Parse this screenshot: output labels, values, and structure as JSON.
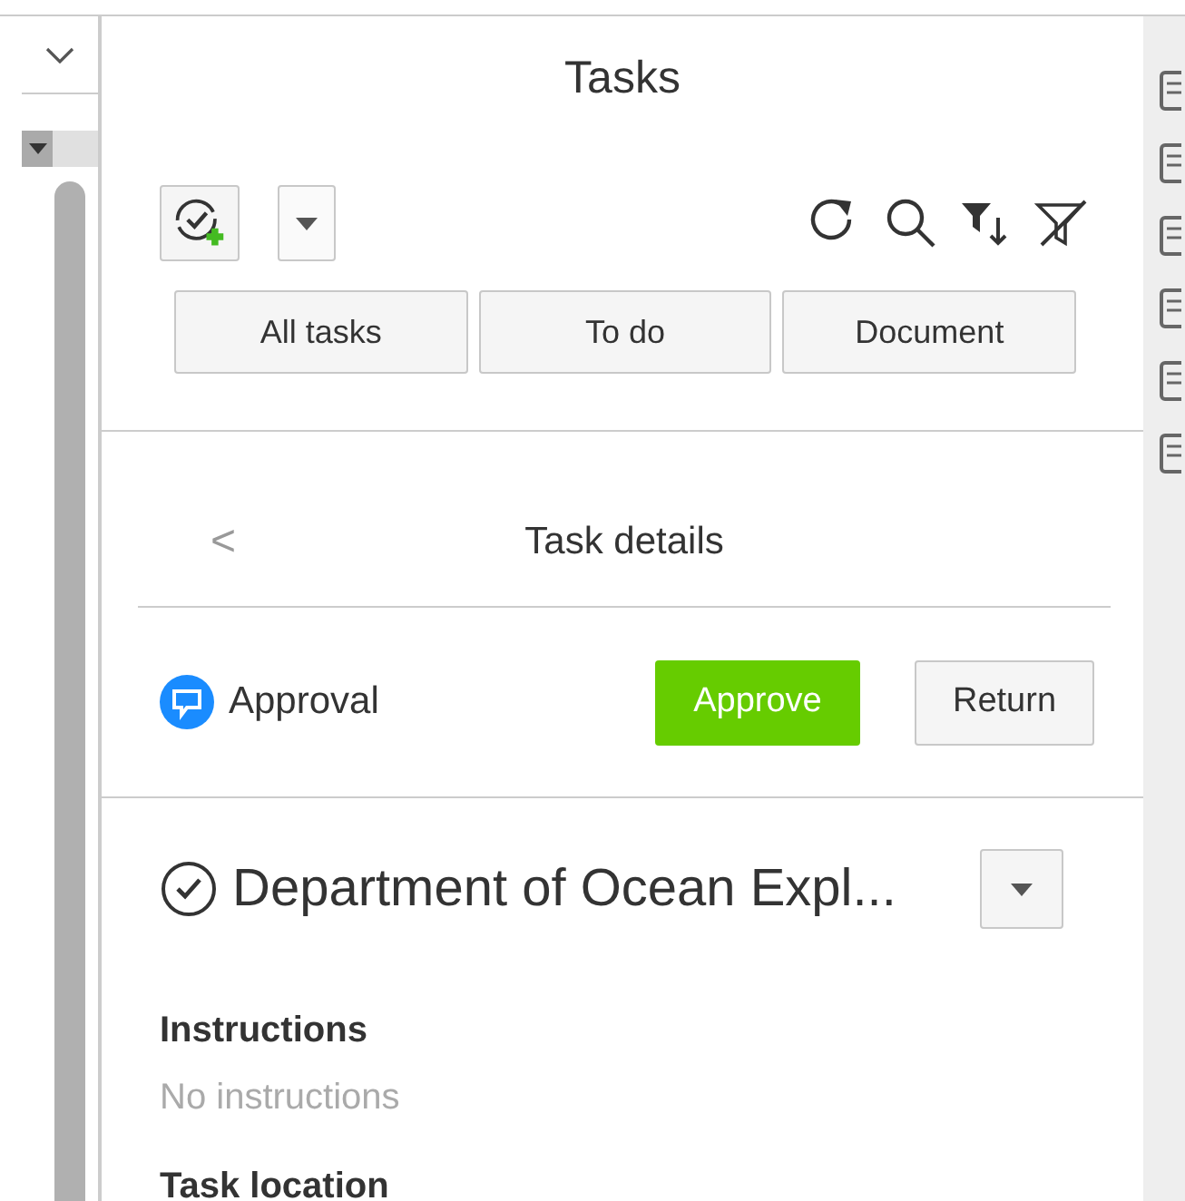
{
  "panel": {
    "title": "Tasks"
  },
  "filters": [
    {
      "label": "All tasks",
      "selected": false
    },
    {
      "label": "To do",
      "selected": false
    },
    {
      "label": "Document",
      "selected": false
    }
  ],
  "details": {
    "back": "<",
    "title": "Task details"
  },
  "approval": {
    "label": "Approval",
    "approve": "Approve",
    "return": "Return"
  },
  "task": {
    "title": "Department of Ocean Expl...",
    "sections": [
      {
        "heading": "Instructions",
        "value": "No instructions"
      },
      {
        "heading": "Task location"
      }
    ]
  }
}
